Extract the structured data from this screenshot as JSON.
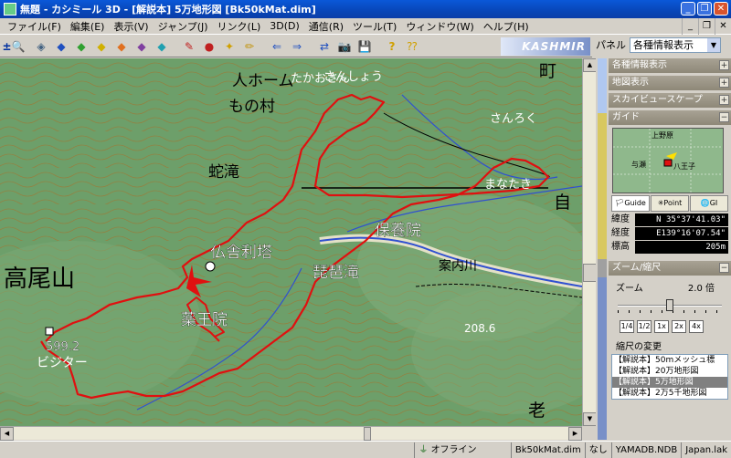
{
  "window": {
    "title": "無題 - カシミール 3D - [解説本] 5万地形図 [Bk50kMat.dim]",
    "buttons": [
      "_",
      "❐",
      "✕"
    ]
  },
  "menu": {
    "items": [
      "ファイル(F)",
      "編集(E)",
      "表示(V)",
      "ジャンプ(J)",
      "リンク(L)",
      "3D(D)",
      "通信(R)",
      "ツール(T)",
      "ウィンドウ(W)",
      "ヘルプ(H)"
    ]
  },
  "toolbar": {
    "logo": "KASHMIR 3D"
  },
  "panel": {
    "label": "パネル",
    "select_value": "各種情報表示"
  },
  "sections": {
    "info": "各種情報表示",
    "map_display": "地図表示",
    "skyview": "スカイビュースケープ",
    "guide": "ガイド",
    "zoom": "ズーム/縮尺"
  },
  "guide": {
    "map_labels": [
      "与瀬",
      "八王子",
      "上野原"
    ],
    "tabs": [
      "Guide",
      "Point",
      "GI"
    ],
    "lat_label": "緯度",
    "lat_value": "N 35°37'41.03\"",
    "lon_label": "経度",
    "lon_value": "E139°16'07.54\"",
    "alt_label": "標高",
    "alt_value": "205m"
  },
  "zoom": {
    "label": "ズーム",
    "value": "2.0 倍",
    "slider_fraction": 0.5,
    "buttons": [
      "1/4",
      "1/2",
      "1x",
      "2x",
      "4x"
    ],
    "scale_label": "縮尺の変更",
    "scale_list": [
      "【解説本】50mメッシュ標",
      "【解説本】20万地形図",
      "【解説本】5万地形図",
      "【解説本】2万5千地形図"
    ],
    "scale_selected": 2
  },
  "map": {
    "labels": [
      "高尾山",
      "599.2",
      "ビジター",
      "薬王院",
      "仏舎利塔",
      "琵琶滝",
      "蛇滝",
      "人ホーム",
      "もの村",
      "さんしょう",
      "たかおさん",
      "さんろく",
      "まなたき",
      "保養院",
      "自",
      "町",
      "老",
      "208.6",
      "案内川"
    ]
  },
  "status": {
    "online": "オフライン",
    "file": "Bk50kMat.dim",
    "none": "なし",
    "db": "YAMADB.NDB",
    "lak": "Japan.lak"
  },
  "colors": {
    "title_bar": "#0846b8",
    "map_base": "#6d9f6a",
    "route": "#e01010",
    "contour": "#b06a20",
    "river": "#3050d0"
  }
}
